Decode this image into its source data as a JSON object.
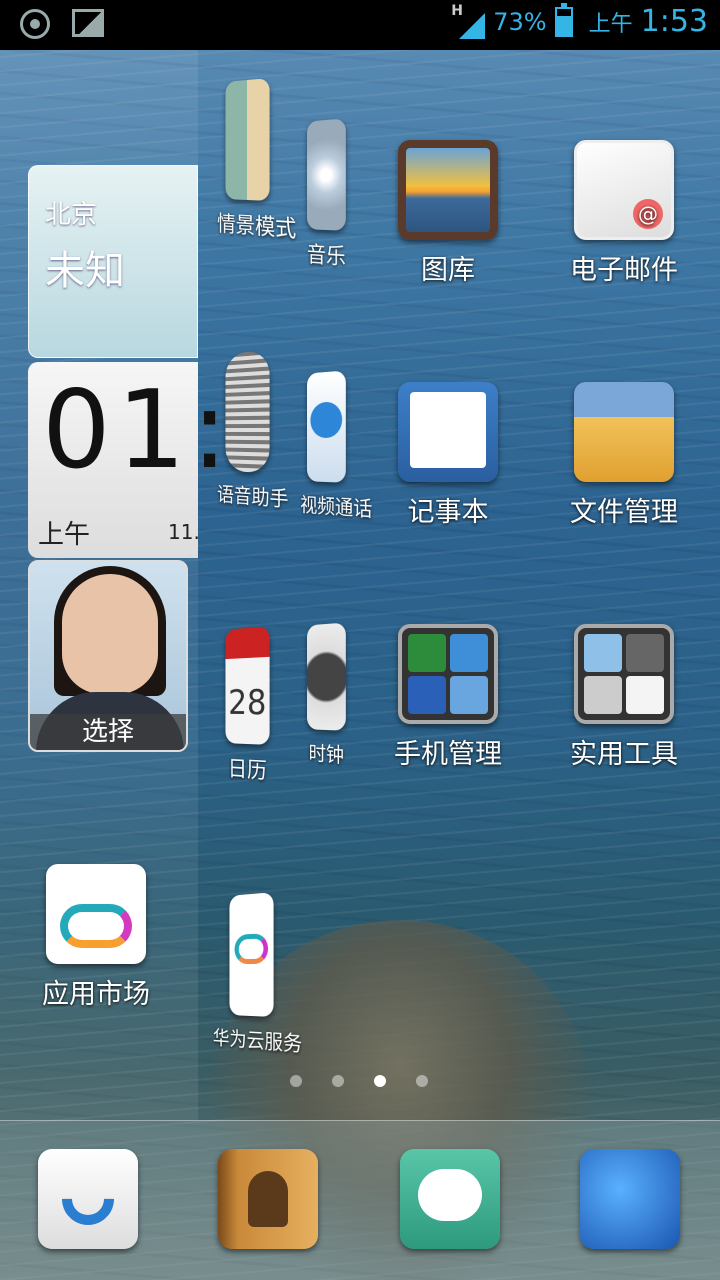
{
  "status_bar": {
    "network": "H",
    "battery_percent": "73%",
    "ampm": "上午",
    "time": "1:53",
    "left_icons": [
      "gps-icon",
      "image-icon"
    ]
  },
  "widgets": {
    "weather": {
      "city": "北京",
      "condition": "未知"
    },
    "clock": {
      "big_time": "01:",
      "ampm": "上午",
      "date": "11."
    },
    "contact": {
      "action_label": "选择"
    }
  },
  "apps": [
    {
      "id": "scene-mode",
      "label": "情景模式",
      "icon": "person-card-icon"
    },
    {
      "id": "music",
      "label": "音乐",
      "icon": "cd-icon"
    },
    {
      "id": "gallery",
      "label": "图库",
      "icon": "sunset-photo-icon"
    },
    {
      "id": "email",
      "label": "电子邮件",
      "icon": "envelope-icon"
    },
    {
      "id": "voice-assistant",
      "label": "语音助手",
      "icon": "microphone-icon"
    },
    {
      "id": "video-call",
      "label": "视频通话",
      "icon": "video-phone-icon"
    },
    {
      "id": "notepad",
      "label": "记事本",
      "icon": "notepad-pen-icon"
    },
    {
      "id": "file-manager",
      "label": "文件管理",
      "icon": "folder-icon"
    },
    {
      "id": "calendar",
      "label": "日历",
      "icon": "calendar-icon",
      "day": "28"
    },
    {
      "id": "clock",
      "label": "时钟",
      "icon": "clock-icon"
    },
    {
      "id": "phone-manager",
      "label": "手机管理",
      "icon": "phone-manager-icon"
    },
    {
      "id": "tools",
      "label": "实用工具",
      "icon": "tools-icon"
    },
    {
      "id": "cloud-service",
      "label": "华为云服务",
      "icon": "cloud-icon"
    },
    {
      "id": "app-market",
      "label": "应用市场",
      "icon": "shopping-bag-cloud-icon"
    }
  ],
  "page_indicator": {
    "count": 4,
    "active": 3
  },
  "dock": [
    "phone-icon",
    "contacts-icon",
    "messaging-icon",
    "browser-globe-icon"
  ],
  "colors": {
    "accent": "#33b5e5"
  }
}
